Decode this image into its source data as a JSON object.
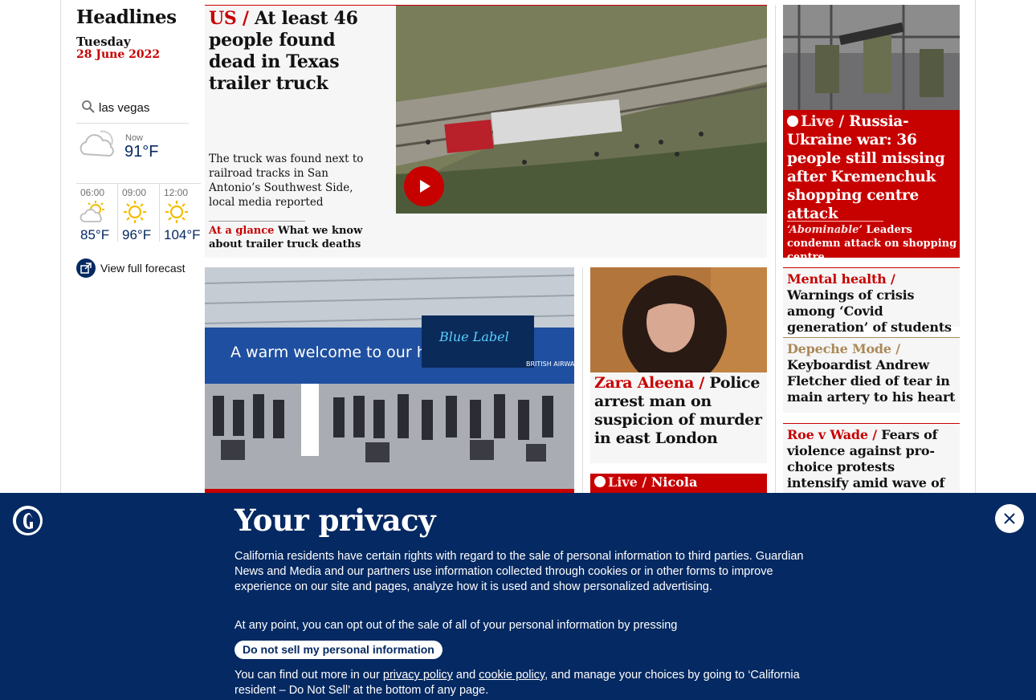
{
  "sidebar": {
    "title": "Headlines",
    "day": "Tuesday",
    "date": "28 June 2022",
    "weather": {
      "location": "las vegas",
      "now_label": "Now",
      "now_temp": "91°F",
      "now_icon": "partly-cloudy-icon",
      "forecast": [
        {
          "time": "06:00",
          "temp": "85°F",
          "icon": "partly-sunny-icon"
        },
        {
          "time": "09:00",
          "temp": "96°F",
          "icon": "sun-icon"
        },
        {
          "time": "12:00",
          "temp": "104°F",
          "icon": "sun-icon"
        }
      ],
      "full_forecast_label": "View full forecast"
    }
  },
  "lead": {
    "kicker": "US /",
    "headline": "At least 46 people found dead in Texas trailer truck",
    "standfirst": "The truck was found next to railroad tracks in San Antonio’s Southwest Side, local media reported",
    "sub_kicker": "At a glance",
    "sub_text": "What we know about trailer truck deaths"
  },
  "russia": {
    "live": "Live /",
    "headline": "Russia-Ukraine war: 36 people still missing after Kremenchuk shopping centre attack",
    "sub_kicker": "‘Abominable’",
    "sub_text": "Leaders condemn attack on shopping centre"
  },
  "small_cards": [
    {
      "kicker": "Mental health /",
      "headline": "Warnings of crisis among ‘Covid generation’ of students",
      "kicker_style": "red"
    },
    {
      "kicker": "Depeche Mode /",
      "headline": "Keyboardist Andrew Fletcher died of tear in main artery to his heart",
      "kicker_style": "gold"
    },
    {
      "kicker": "Roe v Wade /",
      "headline": "Fears of violence against pro-choice protests intensify amid wave of attacks",
      "kicker_style": "red"
    }
  ],
  "zara": {
    "kicker": "Zara Aleena /",
    "headline": "Police arrest man on suspicion of murder in east London"
  },
  "sturgeon": {
    "live": "Live /",
    "headline": "Nicola Sturgeon"
  },
  "airport": {
    "sign_text": "A warm welcome to our home.",
    "screen_text": "Blue Label",
    "brand_text": "BRITISH AIRWAYS"
  },
  "privacy": {
    "title": "Your privacy",
    "p1": "California residents have certain rights with regard to the sale of personal information to third parties. Guardian News and Media and our partners use information collected through cookies or in other forms to improve experience on our site and pages, analyze how it is used and show personalized advertising.",
    "p2": "At any point, you can opt out of the sale of all of your personal information by pressing",
    "button": "Do not sell my personal information",
    "p3_before": "You can find out more in our ",
    "privacy_link": "privacy policy",
    "p3_and": " and ",
    "cookie_link": "cookie policy",
    "p3_after": ", and manage your choices by going to ‘California resident – Do Not Sell’ at the bottom of any page."
  },
  "colors": {
    "brand_blue": "#052962",
    "news_red": "#c70000",
    "culture_gold": "#ab8958"
  }
}
